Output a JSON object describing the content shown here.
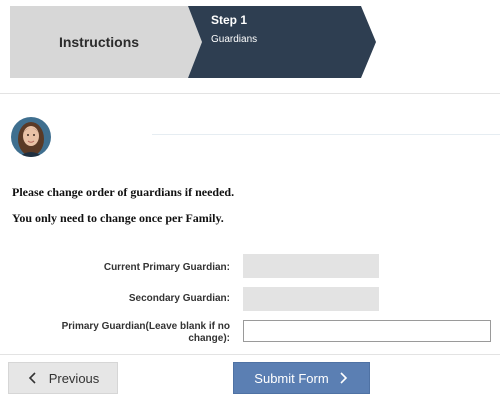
{
  "wizard": {
    "instructions_label": "Instructions",
    "step1_number": "Step 1",
    "step1_name": "Guardians",
    "colors": {
      "inactive_fill": "#d7d7d7",
      "active_fill": "#2e3e51"
    }
  },
  "notices": {
    "line1": "Please change order of guardians if needed.",
    "line2": "You only need to change once per Family."
  },
  "form": {
    "current_primary_label": "Current Primary Guardian:",
    "current_primary_value": "",
    "secondary_label": "Secondary Guardian:",
    "secondary_value": "",
    "primary_input_label": "Primary Guardian(Leave blank if no change):",
    "primary_input_value": "",
    "primary_input_placeholder": ""
  },
  "buttons": {
    "previous_label": "Previous",
    "previous_icon": "chevron-left-icon",
    "submit_label": "Submit Form",
    "submit_icon": "chevron-right-icon",
    "submit_color": "#5b7fb3"
  }
}
